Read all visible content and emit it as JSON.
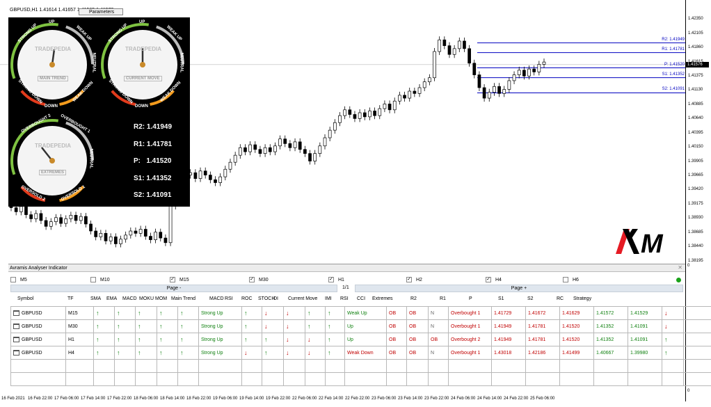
{
  "symbol_header": "GBPUSD,H1  1.41614 1.41657 1.41565 1.41579",
  "parameters_button": "Parameters",
  "gauges": {
    "main_trend": {
      "center_label": "MAIN TREND",
      "brand": "TRADEPEDIA",
      "labels": {
        "up": "UP",
        "strong_up": "STRONG UP",
        "weak_up": "WEAK UP",
        "neutral": "NEUTRAL",
        "strong_down": "STRONG DOWN",
        "weak_down": "WEAK DOWN",
        "down": "DOWN"
      }
    },
    "current_move": {
      "center_label": "CURRENT MOVE",
      "brand": "TRADEPEDIA",
      "labels": {
        "up": "UP",
        "strong_up": "STRONG UP",
        "weak_up": "WEAK UP",
        "neutral": "NEUTRAL",
        "strong_down": "STRONG DOWN",
        "weak_down": "WEAK DOWN",
        "down": "DOWN"
      }
    },
    "extremes": {
      "center_label": "EXTREMES",
      "brand": "TRADEPEDIA",
      "labels": {
        "ob2": "OVERBOUGHT 2",
        "ob1": "OVERBOUGHT 1",
        "neutral": "NEUTRAL",
        "os2": "OVERSOLD 2",
        "os1": "OVERSOLD 1"
      }
    }
  },
  "pivots_panel": [
    {
      "label": "R2:",
      "value": "1.41949"
    },
    {
      "label": "R1:",
      "value": "1.41781"
    },
    {
      "label": "P:",
      "value": "1.41520"
    },
    {
      "label": "S1:",
      "value": "1.41352"
    },
    {
      "label": "S2:",
      "value": "1.41091"
    }
  ],
  "price_scale": [
    "1.42350",
    "1.42105",
    "1.41860",
    "1.41615",
    "1.41375",
    "1.41130",
    "1.40885",
    "1.40640",
    "1.40395",
    "1.40150",
    "1.39905",
    "1.39665",
    "1.39420",
    "1.39175",
    "1.38930",
    "1.38685",
    "1.38440",
    "1.38195"
  ],
  "current_price": "1.41576",
  "levels": [
    {
      "label": "R2: 1.41949",
      "price": 1.41949
    },
    {
      "label": "R1: 1.41781",
      "price": 1.41781
    },
    {
      "label": "P: 1.41520",
      "price": 1.4152
    },
    {
      "label": "S1: 1.41352",
      "price": 1.41352
    },
    {
      "label": "S2: 1.41091",
      "price": 1.41091
    }
  ],
  "time_axis": [
    "16 Feb 2021",
    "16 Feb 22:00",
    "17 Feb 06:00",
    "17 Feb 14:00",
    "17 Feb 22:00",
    "18 Feb 06:00",
    "18 Feb 14:00",
    "18 Feb 22:00",
    "19 Feb 06:00",
    "19 Feb 14:00",
    "19 Feb 22:00",
    "22 Feb 06:00",
    "22 Feb 14:00",
    "22 Feb 22:00",
    "23 Feb 06:00",
    "23 Feb 14:00",
    "23 Feb 22:00",
    "24 Feb 06:00",
    "24 Feb 14:00",
    "24 Feb 22:00",
    "25 Feb 06:00"
  ],
  "analyzer": {
    "title": "Avramis Analyser Indicator",
    "timeframes": [
      {
        "label": "M5",
        "checked": false
      },
      {
        "label": "M10",
        "checked": false
      },
      {
        "label": "M15",
        "checked": true
      },
      {
        "label": "M30",
        "checked": true
      },
      {
        "label": "H1",
        "checked": true
      },
      {
        "label": "H2",
        "checked": true
      },
      {
        "label": "H4",
        "checked": true
      },
      {
        "label": "H6",
        "checked": false
      }
    ],
    "page_prev": "Page -",
    "page_next": "Page +",
    "page_count": "1/1",
    "headers": [
      "Symbol",
      "TF",
      "SMA",
      "EMA",
      "MACD",
      "MOKU",
      "MOM",
      "Main Trend",
      "MACD",
      "RSI",
      "ROC",
      "STOCH",
      "DI",
      "Current Move",
      "IMI",
      "RSI",
      "CCI",
      "Extremes",
      "R2",
      "R1",
      "P",
      "S1",
      "S2",
      "RC",
      "Strategy"
    ],
    "rows": [
      {
        "symbol": "GBPUSD",
        "tf": "M15",
        "sma": "up",
        "ema": "up",
        "macd": "up",
        "moku": "up",
        "mom": "up",
        "main_trend": "Strong Up",
        "macd2": "up",
        "rsi": "dn",
        "roc": "dn",
        "stoch": "up",
        "di": "up",
        "current_move": "Weak Up",
        "imi": "OB",
        "rsi2": "OB",
        "cci": "N",
        "extremes": "Overbought 1",
        "r2": "1.41729",
        "r1": "1.41672",
        "p": "1.41629",
        "s1": "1.41572",
        "s2": "1.41529",
        "rc": "dn",
        "strategy": ""
      },
      {
        "symbol": "GBPUSD",
        "tf": "M30",
        "sma": "up",
        "ema": "up",
        "macd": "up",
        "moku": "up",
        "mom": "up",
        "main_trend": "Strong Up",
        "macd2": "up",
        "rsi": "dn",
        "roc": "dn",
        "stoch": "up",
        "di": "up",
        "current_move": "Up",
        "imi": "OB",
        "rsi2": "OB",
        "cci": "N",
        "extremes": "Overbought 1",
        "r2": "1.41949",
        "r1": "1.41781",
        "p": "1.41520",
        "s1": "1.41352",
        "s2": "1.41091",
        "rc": "dn",
        "strategy": ""
      },
      {
        "symbol": "GBPUSD",
        "tf": "H1",
        "sma": "up",
        "ema": "up",
        "macd": "up",
        "moku": "up",
        "mom": "up",
        "main_trend": "Strong Up",
        "macd2": "up",
        "rsi": "up",
        "roc": "dn",
        "stoch": "dn",
        "di": "up",
        "current_move": "Up",
        "imi": "OB",
        "rsi2": "OB",
        "cci": "OB",
        "extremes": "Overbought 2",
        "r2": "1.41949",
        "r1": "1.41781",
        "p": "1.41520",
        "s1": "1.41352",
        "s2": "1.41091",
        "rc": "up",
        "strategy": ""
      },
      {
        "symbol": "GBPUSD",
        "tf": "H4",
        "sma": "up",
        "ema": "up",
        "macd": "up",
        "moku": "up",
        "mom": "up",
        "main_trend": "Strong Up",
        "macd2": "dn",
        "rsi": "up",
        "roc": "dn",
        "stoch": "dn",
        "di": "up",
        "current_move": "Weak Down",
        "imi": "OB",
        "rsi2": "OB",
        "cci": "N",
        "extremes": "Overbought 1",
        "r2": "1.43018",
        "r1": "1.42186",
        "p": "1.41499",
        "s1": "1.40667",
        "s2": "1.39980",
        "rc": "up",
        "strategy": ""
      }
    ],
    "empty_rows": 2,
    "scale_zero": "0"
  },
  "brand_logo": "XM",
  "colors": {
    "level_line": "#0000c0",
    "up": "#108010",
    "down": "#c00000",
    "panel_bg": "#000000"
  }
}
